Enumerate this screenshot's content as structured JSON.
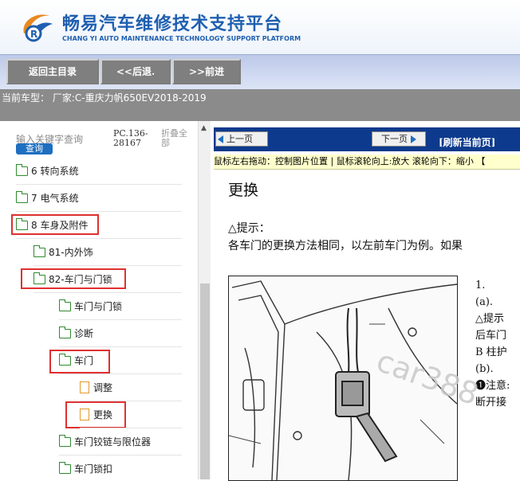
{
  "header": {
    "title_cn": "畅易汽车维修技术支持平台",
    "title_en": "CHANG YI AUTO MAINTENANCE TECHNOLOGY SUPPORT PLATFORM"
  },
  "nav": {
    "home": "返回主目录",
    "back": "<<后退.",
    "forward": ">>前进"
  },
  "vehicle": {
    "text": "当前车型： 厂家:C-重庆力帆650EV2018-2019"
  },
  "sidebar": {
    "search_placeholder": "输入关键字查询",
    "search_button": "查询",
    "pc_code_line1": "PC.136-",
    "pc_code_line2": "28167",
    "collapse_line1": "折叠全",
    "collapse_line2": "部",
    "tree": [
      {
        "label": "6 转向系统",
        "icon": "folder-icon"
      },
      {
        "label": "7 电气系统",
        "icon": "folder-icon"
      },
      {
        "label": "8 车身及附件",
        "icon": "folder-icon",
        "highlighted": true
      },
      {
        "label": "81-内外饰",
        "icon": "folder-icon"
      },
      {
        "label": "82-车门与门锁",
        "icon": "folder-icon",
        "highlighted": true
      },
      {
        "label": "车门与门锁",
        "icon": "folder-icon"
      },
      {
        "label": "诊断",
        "icon": "folder-icon"
      },
      {
        "label": "车门",
        "icon": "folder-icon",
        "highlighted": true
      },
      {
        "label": "调整",
        "icon": "page-icon"
      },
      {
        "label": "更换",
        "icon": "page-icon",
        "highlighted": true
      },
      {
        "label": "车门铰链与限位器",
        "icon": "folder-icon"
      },
      {
        "label": "车门锁扣",
        "icon": "folder-icon"
      }
    ]
  },
  "content": {
    "prev_page": "上一页",
    "next_page": "下一页",
    "refresh": "[刷新当前页]",
    "hint_bar": "鼠标左右拖动：控制图片位置 | 鼠标滚轮向上:放大  滚轮向下：缩小 【",
    "doc_title": "更换",
    "doc_hint": "△提示：",
    "doc_text": "各车门的更换方法相同，以左前车门为例。如果",
    "steps": [
      "1.",
      "(a).",
      "",
      "△提示",
      "后车门",
      "B 柱护",
      "",
      "(b).",
      "❶注意:",
      "断开接"
    ],
    "watermark": "car388"
  },
  "colors": {
    "brand_blue": "#1f5fb0",
    "highlight_red": "#e03030",
    "pager_bg": "#0d3a8c",
    "hint_bg": "#ffffcc"
  }
}
